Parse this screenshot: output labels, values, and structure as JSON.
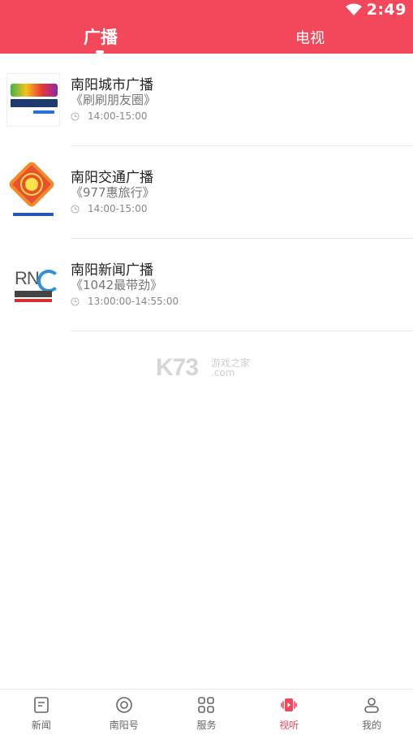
{
  "status": {
    "time": "2:49"
  },
  "tabs": [
    {
      "label": "广播",
      "active": true
    },
    {
      "label": "电视",
      "active": false
    }
  ],
  "stations": [
    {
      "name": "南阳城市广播",
      "program": "《刷刷朋友圈》",
      "time": "14:00-15:00",
      "logo": "city-radio-logo"
    },
    {
      "name": "南阳交通广播",
      "program": "《977惠旅行》",
      "time": "14:00-15:00",
      "logo": "traffic-radio-logo"
    },
    {
      "name": "南阳新闻广播",
      "program": "《1042最带劲》",
      "time": "13:00:00-14:55:00",
      "logo": "news-radio-logo"
    }
  ],
  "watermark": {
    "brand": "K73",
    "text": "游戏之家",
    "url": ".com"
  },
  "nav": [
    {
      "label": "新闻",
      "icon": "news-icon",
      "active": false
    },
    {
      "label": "南阳号",
      "icon": "target-icon",
      "active": false
    },
    {
      "label": "服务",
      "icon": "grid-icon",
      "active": false
    },
    {
      "label": "视听",
      "icon": "video-audio-icon",
      "active": true
    },
    {
      "label": "我的",
      "icon": "profile-icon",
      "active": false
    }
  ],
  "colors": {
    "accent": "#f3475b",
    "text": "#222222",
    "muted": "#888888"
  }
}
